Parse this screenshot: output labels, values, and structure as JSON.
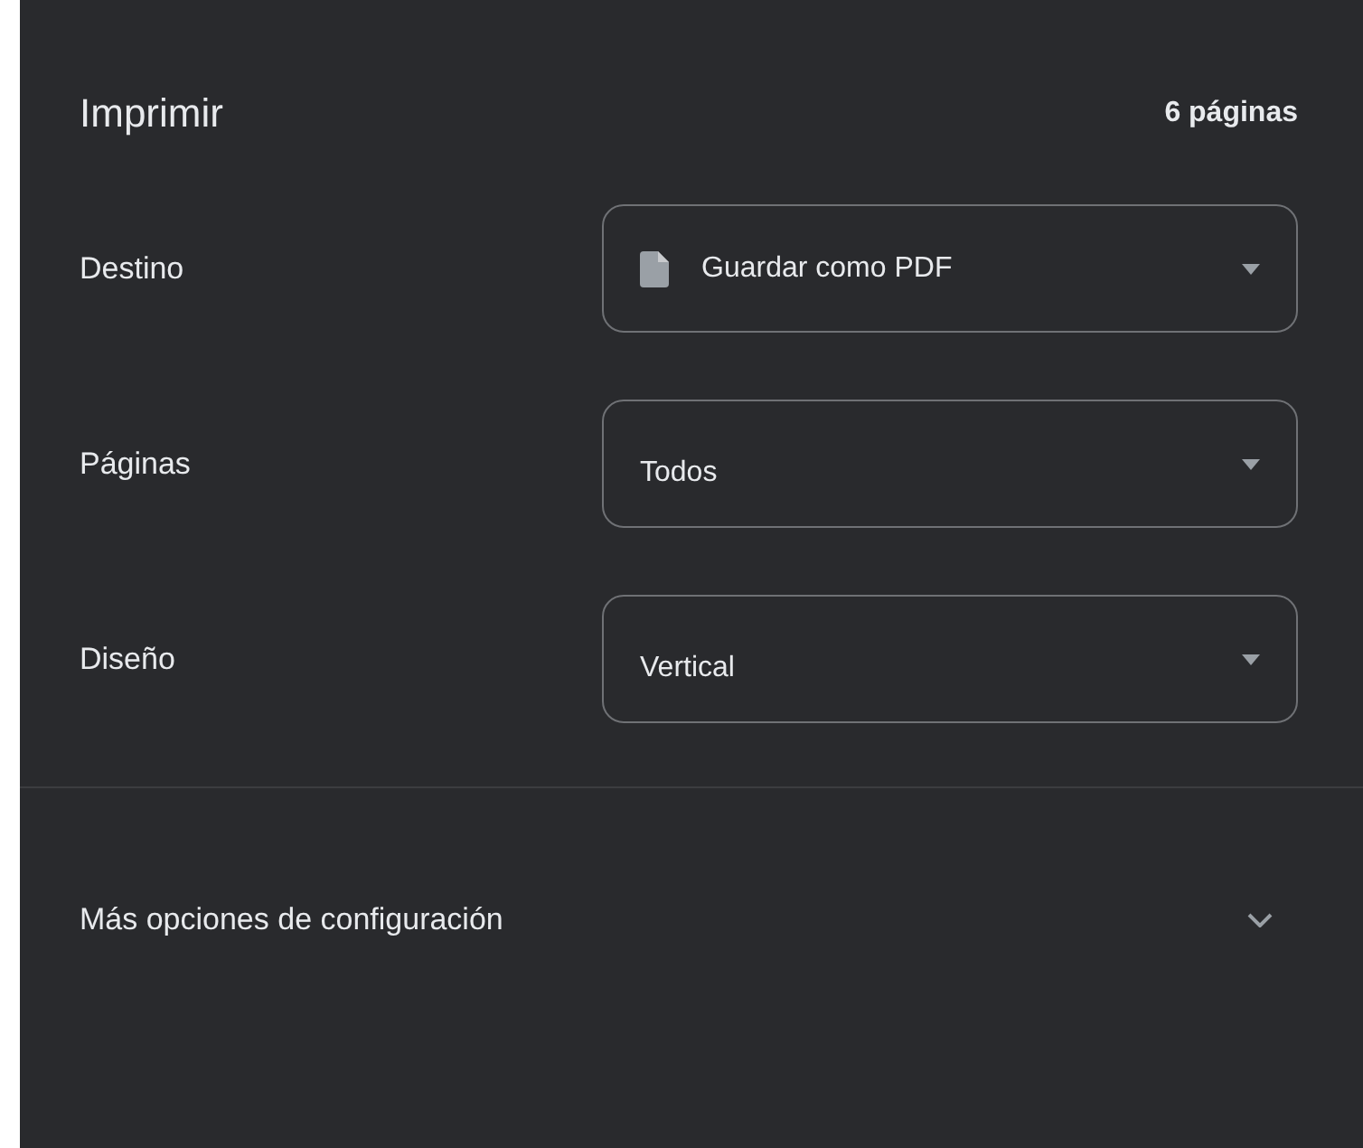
{
  "header": {
    "title": "Imprimir",
    "page_count": "6 páginas"
  },
  "settings": [
    {
      "label": "Destino",
      "value": "Guardar como PDF",
      "kind": "file"
    },
    {
      "label": "Páginas",
      "value": "Todos",
      "kind": "plain"
    },
    {
      "label": "Diseño",
      "value": "Vertical",
      "kind": "plain"
    }
  ],
  "more_options": {
    "label": "Más opciones de configuración",
    "expanded": false
  }
}
